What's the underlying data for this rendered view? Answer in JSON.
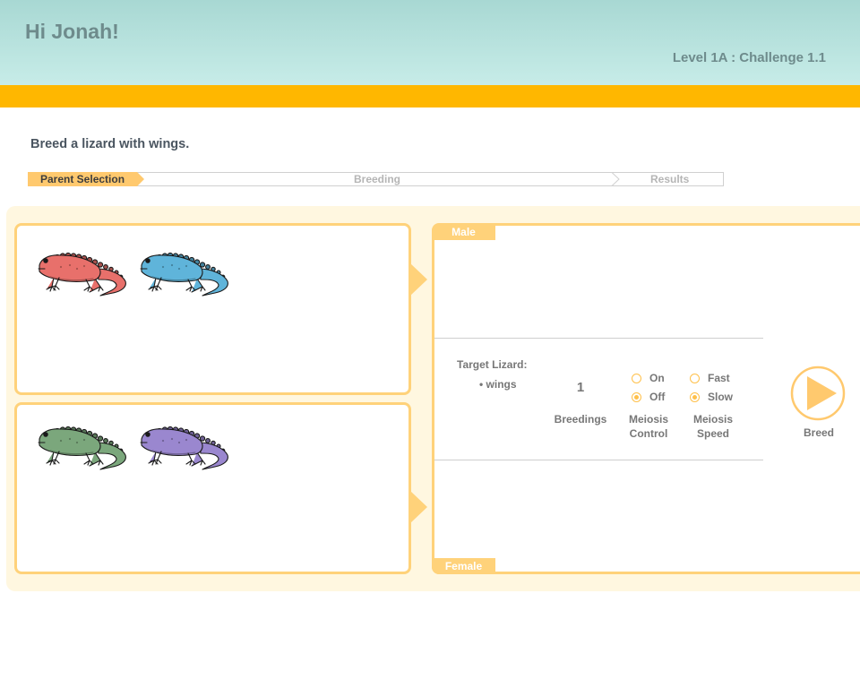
{
  "header": {
    "greeting": "Hi Jonah!",
    "level": "Level 1A : Challenge 1.1"
  },
  "task": {
    "text": "Breed a lizard with wings."
  },
  "progress": {
    "steps": [
      {
        "label": "Parent Selection",
        "state": "active"
      },
      {
        "label": "Breeding",
        "state": "inactive"
      },
      {
        "label": "Results",
        "state": "inactive"
      }
    ]
  },
  "parents": {
    "top_row": [
      {
        "color": "#e8706b",
        "name": "red-lizard"
      },
      {
        "color": "#5fb4da",
        "name": "blue-lizard"
      }
    ],
    "bottom_row": [
      {
        "color": "#7ba77c",
        "name": "green-lizard"
      },
      {
        "color": "#9a87cf",
        "name": "purple-lizard"
      }
    ]
  },
  "breeding": {
    "male_tag": "Male",
    "female_tag": "Female",
    "target_label": "Target Lizard:",
    "target_traits": [
      "• wings"
    ],
    "breedings_count": "1",
    "breedings_label": "Breedings",
    "meiosis_control": {
      "label_line1": "Meiosis",
      "label_line2": "Control",
      "options": [
        {
          "label": "On",
          "checked": false
        },
        {
          "label": "Off",
          "checked": true
        }
      ]
    },
    "meiosis_speed": {
      "label_line1": "Meiosis",
      "label_line2": "Speed",
      "options": [
        {
          "label": "Fast",
          "checked": false
        },
        {
          "label": "Slow",
          "checked": true
        }
      ]
    },
    "breed_button_label": "Breed"
  },
  "colors": {
    "accent": "#ffb700",
    "panel_border": "#ffd27a",
    "header_start": "#a8d8d3",
    "header_end": "#c7ece8"
  }
}
